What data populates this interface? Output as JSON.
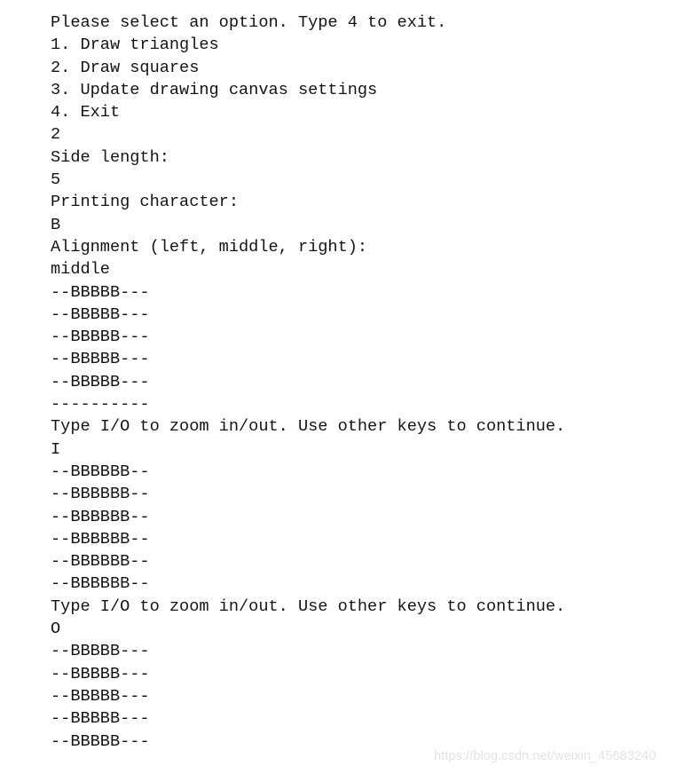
{
  "terminal": {
    "lines": [
      "Please select an option. Type 4 to exit.",
      "1. Draw triangles",
      "2. Draw squares",
      "3. Update drawing canvas settings",
      "4. Exit",
      "2",
      "Side length:",
      "5",
      "Printing character:",
      "B",
      "Alignment (left, middle, right):",
      "middle",
      "--BBBBB---",
      "--BBBBB---",
      "--BBBBB---",
      "--BBBBB---",
      "--BBBBB---",
      "----------",
      "Type I/O to zoom in/out. Use other keys to continue.",
      "I",
      "--BBBBBB--",
      "--BBBBBB--",
      "--BBBBBB--",
      "--BBBBBB--",
      "--BBBBBB--",
      "--BBBBBB--",
      "Type I/O to zoom in/out. Use other keys to continue.",
      "O",
      "--BBBBB---",
      "--BBBBB---",
      "--BBBBB---",
      "--BBBBB---",
      "--BBBBB---"
    ],
    "menu": {
      "prompt": "Please select an option. Type 4 to exit.",
      "options": [
        "1. Draw triangles",
        "2. Draw squares",
        "3. Update drawing canvas settings",
        "4. Exit"
      ],
      "selected_option": "2"
    },
    "inputs": {
      "side_length_prompt": "Side length:",
      "side_length_value": "5",
      "printing_character_prompt": "Printing character:",
      "printing_character_value": "B",
      "alignment_prompt": "Alignment (left, middle, right):",
      "alignment_value": "middle",
      "zoom_prompt": "Type I/O to zoom in/out. Use other keys to continue.",
      "zoom_in_value": "I",
      "zoom_out_value": "O"
    },
    "canvas": {
      "width_chars": 10,
      "fill_char": "B",
      "pad_char": "-",
      "render_1": [
        "--BBBBB---",
        "--BBBBB---",
        "--BBBBB---",
        "--BBBBB---",
        "--BBBBB---",
        "----------"
      ],
      "render_2": [
        "--BBBBBB--",
        "--BBBBBB--",
        "--BBBBBB--",
        "--BBBBBB--",
        "--BBBBBB--",
        "--BBBBBB--"
      ],
      "render_3": [
        "--BBBBB---",
        "--BBBBB---",
        "--BBBBB---",
        "--BBBBB---",
        "--BBBBB---"
      ]
    },
    "colors": {
      "text": "#141414",
      "background": "#ffffff",
      "watermark": "#e3e3e3"
    }
  },
  "watermark": {
    "text": "https://blog.csdn.net/weixin_45683240"
  }
}
